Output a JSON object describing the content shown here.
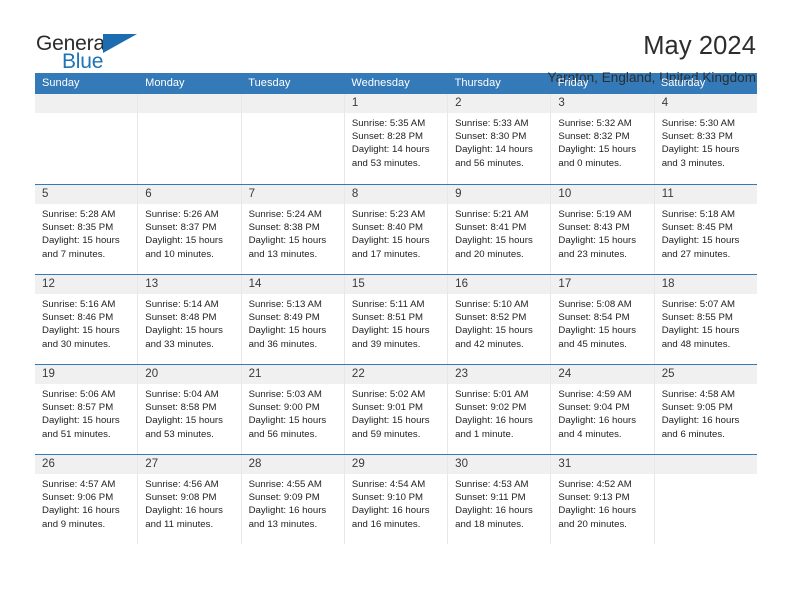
{
  "brand": {
    "name_part1": "General",
    "name_part2": "Blue",
    "color_primary": "#1b6cb0",
    "color_dark": "#2b2b2b"
  },
  "header": {
    "title": "May 2024",
    "subtitle": "Yarnton, England, United Kingdom"
  },
  "theme": {
    "header_bar_color": "#3479b8",
    "day_band_color": "#f0f0f0",
    "row_divider_color": "#3479b8",
    "cell_divider_color": "#e8e8e8"
  },
  "weekday_headers": [
    "Sunday",
    "Monday",
    "Tuesday",
    "Wednesday",
    "Thursday",
    "Friday",
    "Saturday"
  ],
  "weeks": [
    [
      {
        "day": "",
        "empty": true
      },
      {
        "day": "",
        "empty": true
      },
      {
        "day": "",
        "empty": true
      },
      {
        "day": "1",
        "sunrise": "Sunrise: 5:35 AM",
        "sunset": "Sunset: 8:28 PM",
        "daylight": "Daylight: 14 hours and 53 minutes."
      },
      {
        "day": "2",
        "sunrise": "Sunrise: 5:33 AM",
        "sunset": "Sunset: 8:30 PM",
        "daylight": "Daylight: 14 hours and 56 minutes."
      },
      {
        "day": "3",
        "sunrise": "Sunrise: 5:32 AM",
        "sunset": "Sunset: 8:32 PM",
        "daylight": "Daylight: 15 hours and 0 minutes."
      },
      {
        "day": "4",
        "sunrise": "Sunrise: 5:30 AM",
        "sunset": "Sunset: 8:33 PM",
        "daylight": "Daylight: 15 hours and 3 minutes."
      }
    ],
    [
      {
        "day": "5",
        "sunrise": "Sunrise: 5:28 AM",
        "sunset": "Sunset: 8:35 PM",
        "daylight": "Daylight: 15 hours and 7 minutes."
      },
      {
        "day": "6",
        "sunrise": "Sunrise: 5:26 AM",
        "sunset": "Sunset: 8:37 PM",
        "daylight": "Daylight: 15 hours and 10 minutes."
      },
      {
        "day": "7",
        "sunrise": "Sunrise: 5:24 AM",
        "sunset": "Sunset: 8:38 PM",
        "daylight": "Daylight: 15 hours and 13 minutes."
      },
      {
        "day": "8",
        "sunrise": "Sunrise: 5:23 AM",
        "sunset": "Sunset: 8:40 PM",
        "daylight": "Daylight: 15 hours and 17 minutes."
      },
      {
        "day": "9",
        "sunrise": "Sunrise: 5:21 AM",
        "sunset": "Sunset: 8:41 PM",
        "daylight": "Daylight: 15 hours and 20 minutes."
      },
      {
        "day": "10",
        "sunrise": "Sunrise: 5:19 AM",
        "sunset": "Sunset: 8:43 PM",
        "daylight": "Daylight: 15 hours and 23 minutes."
      },
      {
        "day": "11",
        "sunrise": "Sunrise: 5:18 AM",
        "sunset": "Sunset: 8:45 PM",
        "daylight": "Daylight: 15 hours and 27 minutes."
      }
    ],
    [
      {
        "day": "12",
        "sunrise": "Sunrise: 5:16 AM",
        "sunset": "Sunset: 8:46 PM",
        "daylight": "Daylight: 15 hours and 30 minutes."
      },
      {
        "day": "13",
        "sunrise": "Sunrise: 5:14 AM",
        "sunset": "Sunset: 8:48 PM",
        "daylight": "Daylight: 15 hours and 33 minutes."
      },
      {
        "day": "14",
        "sunrise": "Sunrise: 5:13 AM",
        "sunset": "Sunset: 8:49 PM",
        "daylight": "Daylight: 15 hours and 36 minutes."
      },
      {
        "day": "15",
        "sunrise": "Sunrise: 5:11 AM",
        "sunset": "Sunset: 8:51 PM",
        "daylight": "Daylight: 15 hours and 39 minutes."
      },
      {
        "day": "16",
        "sunrise": "Sunrise: 5:10 AM",
        "sunset": "Sunset: 8:52 PM",
        "daylight": "Daylight: 15 hours and 42 minutes."
      },
      {
        "day": "17",
        "sunrise": "Sunrise: 5:08 AM",
        "sunset": "Sunset: 8:54 PM",
        "daylight": "Daylight: 15 hours and 45 minutes."
      },
      {
        "day": "18",
        "sunrise": "Sunrise: 5:07 AM",
        "sunset": "Sunset: 8:55 PM",
        "daylight": "Daylight: 15 hours and 48 minutes."
      }
    ],
    [
      {
        "day": "19",
        "sunrise": "Sunrise: 5:06 AM",
        "sunset": "Sunset: 8:57 PM",
        "daylight": "Daylight: 15 hours and 51 minutes."
      },
      {
        "day": "20",
        "sunrise": "Sunrise: 5:04 AM",
        "sunset": "Sunset: 8:58 PM",
        "daylight": "Daylight: 15 hours and 53 minutes."
      },
      {
        "day": "21",
        "sunrise": "Sunrise: 5:03 AM",
        "sunset": "Sunset: 9:00 PM",
        "daylight": "Daylight: 15 hours and 56 minutes."
      },
      {
        "day": "22",
        "sunrise": "Sunrise: 5:02 AM",
        "sunset": "Sunset: 9:01 PM",
        "daylight": "Daylight: 15 hours and 59 minutes."
      },
      {
        "day": "23",
        "sunrise": "Sunrise: 5:01 AM",
        "sunset": "Sunset: 9:02 PM",
        "daylight": "Daylight: 16 hours and 1 minute."
      },
      {
        "day": "24",
        "sunrise": "Sunrise: 4:59 AM",
        "sunset": "Sunset: 9:04 PM",
        "daylight": "Daylight: 16 hours and 4 minutes."
      },
      {
        "day": "25",
        "sunrise": "Sunrise: 4:58 AM",
        "sunset": "Sunset: 9:05 PM",
        "daylight": "Daylight: 16 hours and 6 minutes."
      }
    ],
    [
      {
        "day": "26",
        "sunrise": "Sunrise: 4:57 AM",
        "sunset": "Sunset: 9:06 PM",
        "daylight": "Daylight: 16 hours and 9 minutes."
      },
      {
        "day": "27",
        "sunrise": "Sunrise: 4:56 AM",
        "sunset": "Sunset: 9:08 PM",
        "daylight": "Daylight: 16 hours and 11 minutes."
      },
      {
        "day": "28",
        "sunrise": "Sunrise: 4:55 AM",
        "sunset": "Sunset: 9:09 PM",
        "daylight": "Daylight: 16 hours and 13 minutes."
      },
      {
        "day": "29",
        "sunrise": "Sunrise: 4:54 AM",
        "sunset": "Sunset: 9:10 PM",
        "daylight": "Daylight: 16 hours and 16 minutes."
      },
      {
        "day": "30",
        "sunrise": "Sunrise: 4:53 AM",
        "sunset": "Sunset: 9:11 PM",
        "daylight": "Daylight: 16 hours and 18 minutes."
      },
      {
        "day": "31",
        "sunrise": "Sunrise: 4:52 AM",
        "sunset": "Sunset: 9:13 PM",
        "daylight": "Daylight: 16 hours and 20 minutes."
      },
      {
        "day": "",
        "empty": true
      }
    ]
  ]
}
